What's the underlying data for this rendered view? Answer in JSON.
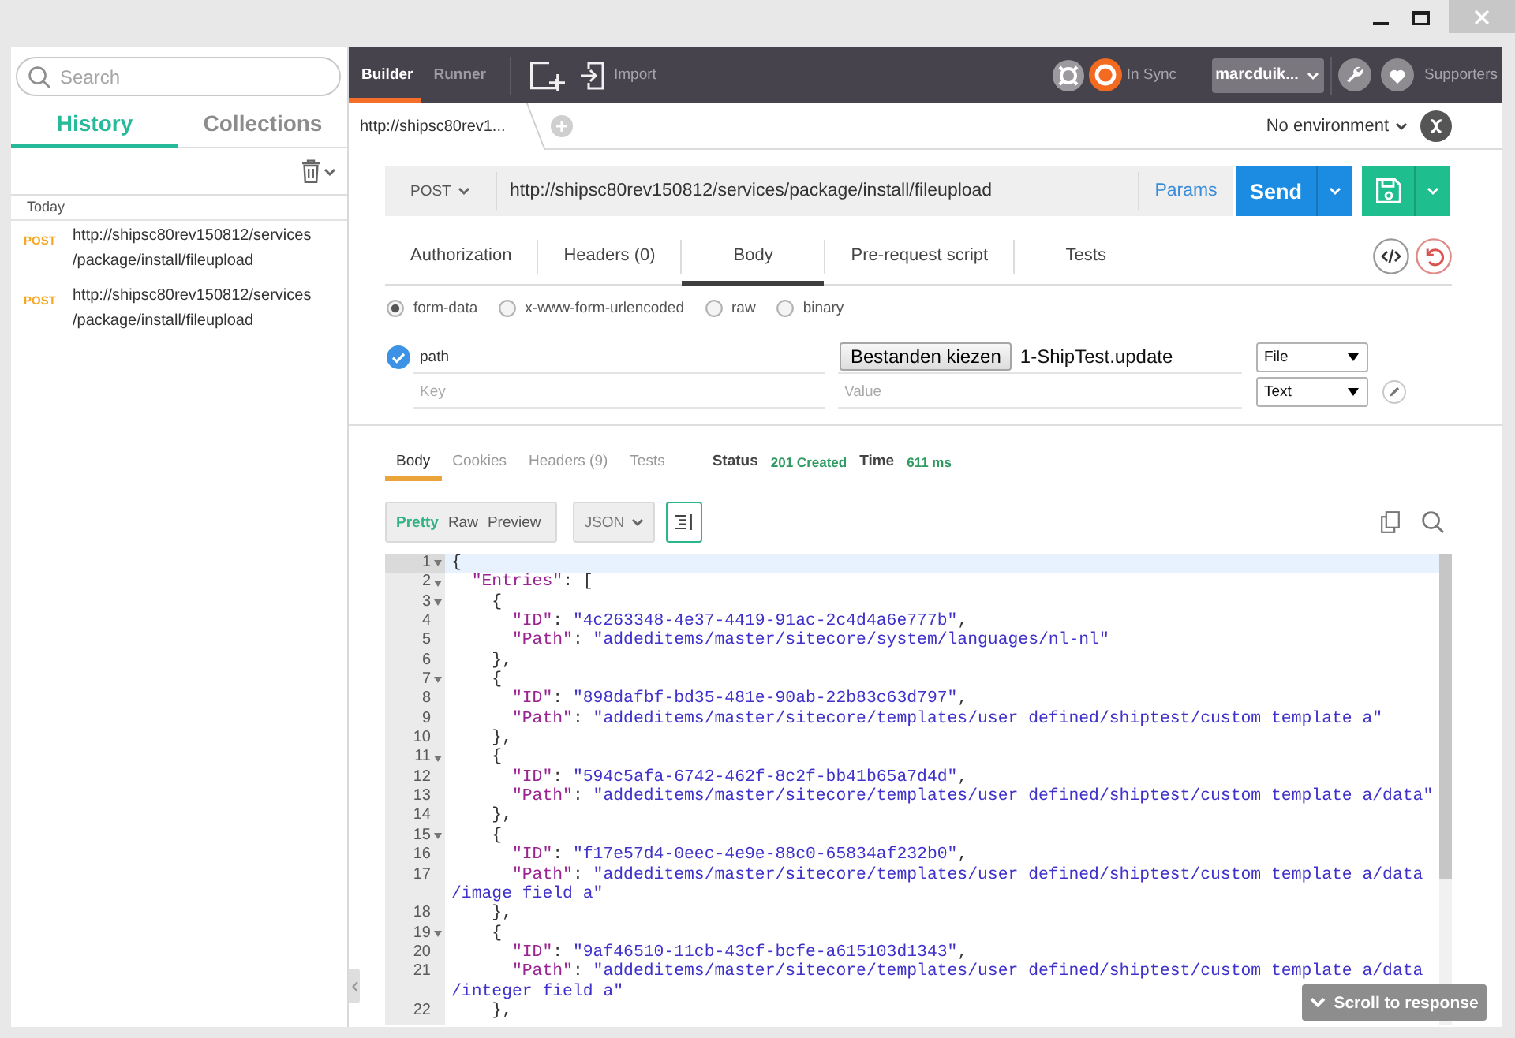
{
  "sidebar": {
    "search": {
      "placeholder": "Search"
    },
    "tabs": [
      {
        "label": "History",
        "selected": true
      },
      {
        "label": "Collections",
        "selected": false
      }
    ],
    "groups": [
      {
        "label": "Today",
        "items": [
          {
            "method": "POST",
            "url": "http://shipsc80rev150812/services/package/install/fileupload"
          },
          {
            "method": "POST",
            "url": "http://shipsc80rev150812/services/package/install/fileupload"
          }
        ]
      }
    ]
  },
  "toolbar": {
    "tabs": [
      {
        "label": "Builder",
        "selected": true
      },
      {
        "label": "Runner",
        "selected": false
      }
    ],
    "import_label": "Import",
    "sync_status": "In Sync",
    "user": "marcduik...",
    "supporters_label": "Supporters"
  },
  "request_tabs": [
    {
      "label": "http://shipsc80rev1...",
      "selected": true
    }
  ],
  "environment": {
    "label": "No environment"
  },
  "request": {
    "method": "POST",
    "url": "http://shipsc80rev150812/services/package/install/fileupload",
    "params_label": "Params",
    "send_label": "Send",
    "tabs": [
      {
        "label": "Authorization",
        "selected": false
      },
      {
        "label": "Headers (0)",
        "selected": false
      },
      {
        "label": "Body",
        "selected": true
      },
      {
        "label": "Pre-request script",
        "selected": false
      },
      {
        "label": "Tests",
        "selected": false
      }
    ],
    "body_modes": [
      {
        "label": "form-data",
        "selected": true
      },
      {
        "label": "x-www-form-urlencoded",
        "selected": false
      },
      {
        "label": "raw",
        "selected": false
      },
      {
        "label": "binary",
        "selected": false
      }
    ],
    "form_rows": [
      {
        "kind": "file",
        "checked": true,
        "key": "path",
        "file_button": "Bestanden kiezen",
        "file_name": "1-ShipTest.update",
        "type": "File"
      },
      {
        "kind": "text",
        "checked": false,
        "key_placeholder": "Key",
        "value_placeholder": "Value",
        "type": "Text"
      }
    ]
  },
  "response": {
    "tabs": [
      {
        "label": "Body",
        "selected": true
      },
      {
        "label": "Cookies",
        "selected": false
      },
      {
        "label": "Headers (9)",
        "selected": false
      },
      {
        "label": "Tests",
        "selected": false
      }
    ],
    "status_label": "Status",
    "status": "201 Created",
    "time_label": "Time",
    "time": "611 ms",
    "views": [
      {
        "label": "Pretty",
        "selected": true
      },
      {
        "label": "Raw",
        "selected": false
      },
      {
        "label": "Preview",
        "selected": false
      }
    ],
    "format": "JSON",
    "line_wrap": true,
    "lines": [
      {
        "number": "1",
        "fold": true,
        "active": true,
        "text": "{"
      },
      {
        "number": "2",
        "fold": true,
        "active": false,
        "text": "  \"Entries\": ["
      },
      {
        "number": "3",
        "fold": true,
        "active": false,
        "text": "    {"
      },
      {
        "number": "4",
        "fold": false,
        "active": false,
        "text": "      \"ID\": \"4c263348-4e37-4419-91ac-2c4d4a6e777b\","
      },
      {
        "number": "5",
        "fold": false,
        "active": false,
        "text": "      \"Path\": \"addeditems/master/sitecore/system/languages/nl-nl\""
      },
      {
        "number": "6",
        "fold": false,
        "active": false,
        "text": "    },"
      },
      {
        "number": "7",
        "fold": true,
        "active": false,
        "text": "    {"
      },
      {
        "number": "8",
        "fold": false,
        "active": false,
        "text": "      \"ID\": \"898dafbf-bd35-481e-90ab-22b83c63d797\","
      },
      {
        "number": "9",
        "fold": false,
        "active": false,
        "text": "      \"Path\": \"addeditems/master/sitecore/templates/user defined/shiptest/custom template a\""
      },
      {
        "number": "10",
        "fold": false,
        "active": false,
        "text": "    },"
      },
      {
        "number": "11",
        "fold": true,
        "active": false,
        "text": "    {"
      },
      {
        "number": "12",
        "fold": false,
        "active": false,
        "text": "      \"ID\": \"594c5afa-6742-462f-8c2f-bb41b65a7d4d\","
      },
      {
        "number": "13",
        "fold": false,
        "active": false,
        "text": "      \"Path\": \"addeditems/master/sitecore/templates/user defined/shiptest/custom template a/data\""
      },
      {
        "number": "14",
        "fold": false,
        "active": false,
        "text": "    },"
      },
      {
        "number": "15",
        "fold": true,
        "active": false,
        "text": "    {"
      },
      {
        "number": "16",
        "fold": false,
        "active": false,
        "text": "      \"ID\": \"f17e57d4-0eec-4e9e-88c0-65834af232b0\","
      },
      {
        "number": "17",
        "fold": false,
        "active": false,
        "text": "      \"Path\": \"addeditems/master/sitecore/templates/user defined/shiptest/custom template a/data",
        "continuation": "/image field a\""
      },
      {
        "number": "18",
        "fold": false,
        "active": false,
        "text": "    },"
      },
      {
        "number": "19",
        "fold": true,
        "active": false,
        "text": "    {"
      },
      {
        "number": "20",
        "fold": false,
        "active": false,
        "text": "      \"ID\": \"9af46510-11cb-43cf-bcfe-a615103d1343\","
      },
      {
        "number": "21",
        "fold": false,
        "active": false,
        "text": "      \"Path\": \"addeditems/master/sitecore/templates/user defined/shiptest/custom template a/data",
        "continuation": "/integer field a\""
      },
      {
        "number": "22",
        "fold": false,
        "active": false,
        "text": "    },"
      }
    ],
    "scroll_button": "Scroll to response"
  }
}
